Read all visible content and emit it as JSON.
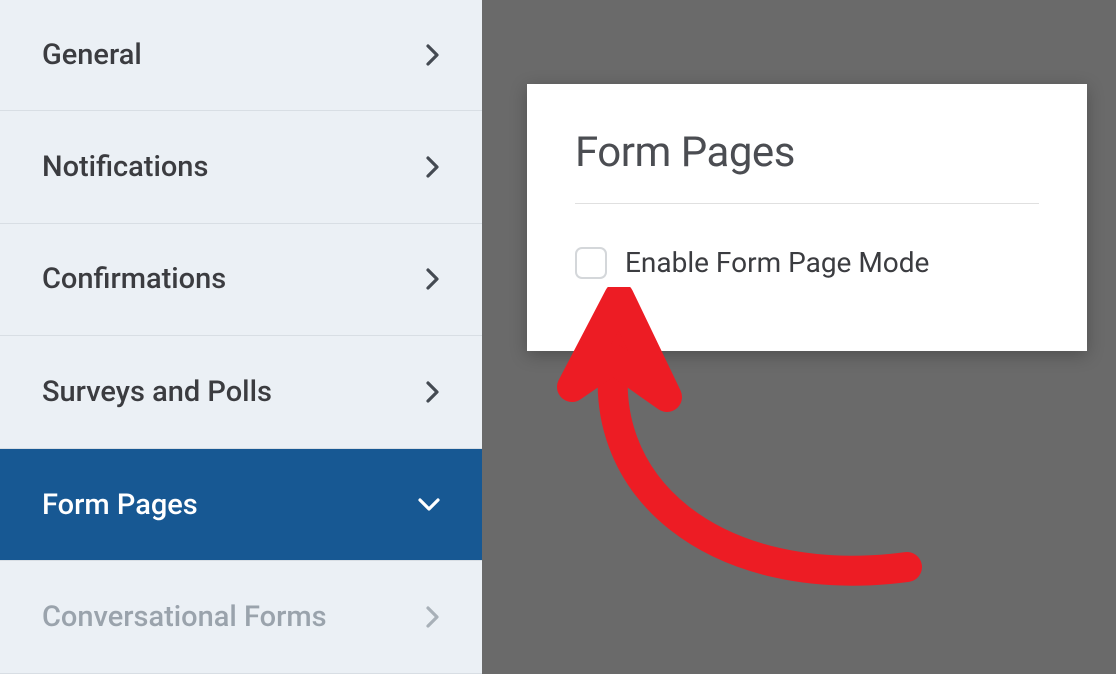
{
  "sidebar": {
    "items": [
      {
        "label": "General",
        "active": false
      },
      {
        "label": "Notifications",
        "active": false
      },
      {
        "label": "Confirmations",
        "active": false
      },
      {
        "label": "Surveys and Polls",
        "active": false
      },
      {
        "label": "Form Pages",
        "active": true
      },
      {
        "label": "Conversational Forms",
        "active": false,
        "inactive": true
      }
    ]
  },
  "panel": {
    "title": "Form Pages",
    "checkbox_label": "Enable Form Page Mode"
  }
}
